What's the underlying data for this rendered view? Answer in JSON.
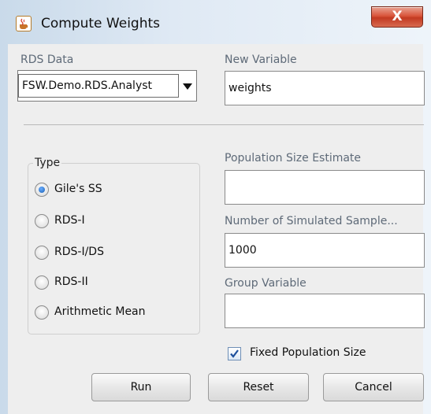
{
  "window": {
    "title": "Compute Weights",
    "close_label": "X"
  },
  "rds_data": {
    "label": "RDS Data",
    "selected": "FSW.Demo.RDS.Analyst"
  },
  "new_variable": {
    "label": "New Variable",
    "value": "weights"
  },
  "type": {
    "title": "Type",
    "options": [
      {
        "label": "Gile's SS",
        "selected": true
      },
      {
        "label": "RDS-I",
        "selected": false
      },
      {
        "label": "RDS-I/DS",
        "selected": false
      },
      {
        "label": "RDS-II",
        "selected": false
      },
      {
        "label": "Arithmetic Mean",
        "selected": false
      }
    ]
  },
  "population_size": {
    "label": "Population Size Estimate",
    "value": ""
  },
  "simulated_samples": {
    "label": "Number of Simulated Sample...",
    "value": "1000"
  },
  "group_variable": {
    "label": "Group Variable",
    "value": ""
  },
  "fixed_population": {
    "label": "Fixed Population Size",
    "checked": true
  },
  "buttons": {
    "run": "Run",
    "reset": "Reset",
    "cancel": "Cancel"
  }
}
